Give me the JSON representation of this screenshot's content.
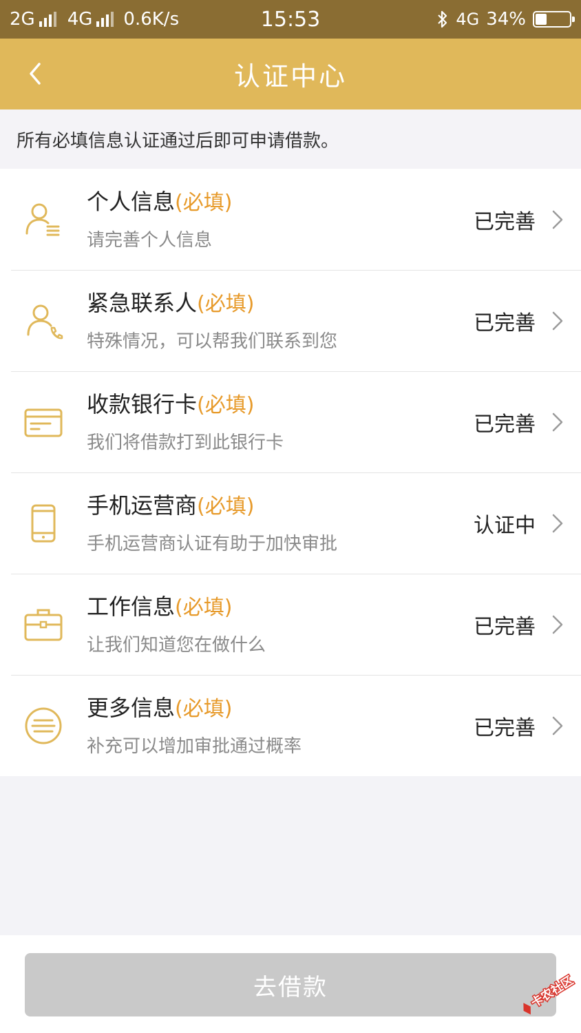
{
  "status_bar": {
    "net1": "2G",
    "net2": "4G",
    "speed": "0.6K/s",
    "time": "15:53",
    "net3": "4G",
    "battery": "34%",
    "battery_level": 0.34
  },
  "header": {
    "title": "认证中心",
    "back_icon": "chevron-left-icon"
  },
  "notice": "所有必填信息认证通过后即可申请借款。",
  "items": [
    {
      "title": "个人信息",
      "required": "(必填)",
      "subtitle": "请完善个人信息",
      "status": "已完善",
      "icon": "person-info-icon"
    },
    {
      "title": "紧急联系人",
      "required": "(必填)",
      "subtitle": "特殊情况，可以帮我们联系到您",
      "status": "已完善",
      "icon": "emergency-contact-icon"
    },
    {
      "title": "收款银行卡",
      "required": "(必填)",
      "subtitle": "我们将借款打到此银行卡",
      "status": "已完善",
      "icon": "bank-card-icon"
    },
    {
      "title": "手机运营商",
      "required": "(必填)",
      "subtitle": "手机运营商认证有助于加快审批",
      "status": "认证中",
      "icon": "phone-icon"
    },
    {
      "title": "工作信息",
      "required": "(必填)",
      "subtitle": "让我们知道您在做什么",
      "status": "已完善",
      "icon": "briefcase-icon"
    },
    {
      "title": "更多信息",
      "required": "(必填)",
      "subtitle": "补充可以增加审批通过概率",
      "status": "已完善",
      "icon": "more-info-icon"
    }
  ],
  "bottom": {
    "button_label": "去借款"
  },
  "colors": {
    "status_bar": "#8a6d33",
    "header": "#e0b85a",
    "accent": "#e79a2a",
    "icon": "#e0b85a",
    "button_disabled": "#c9c9c9"
  },
  "watermark": {
    "text": "卡农社区"
  }
}
